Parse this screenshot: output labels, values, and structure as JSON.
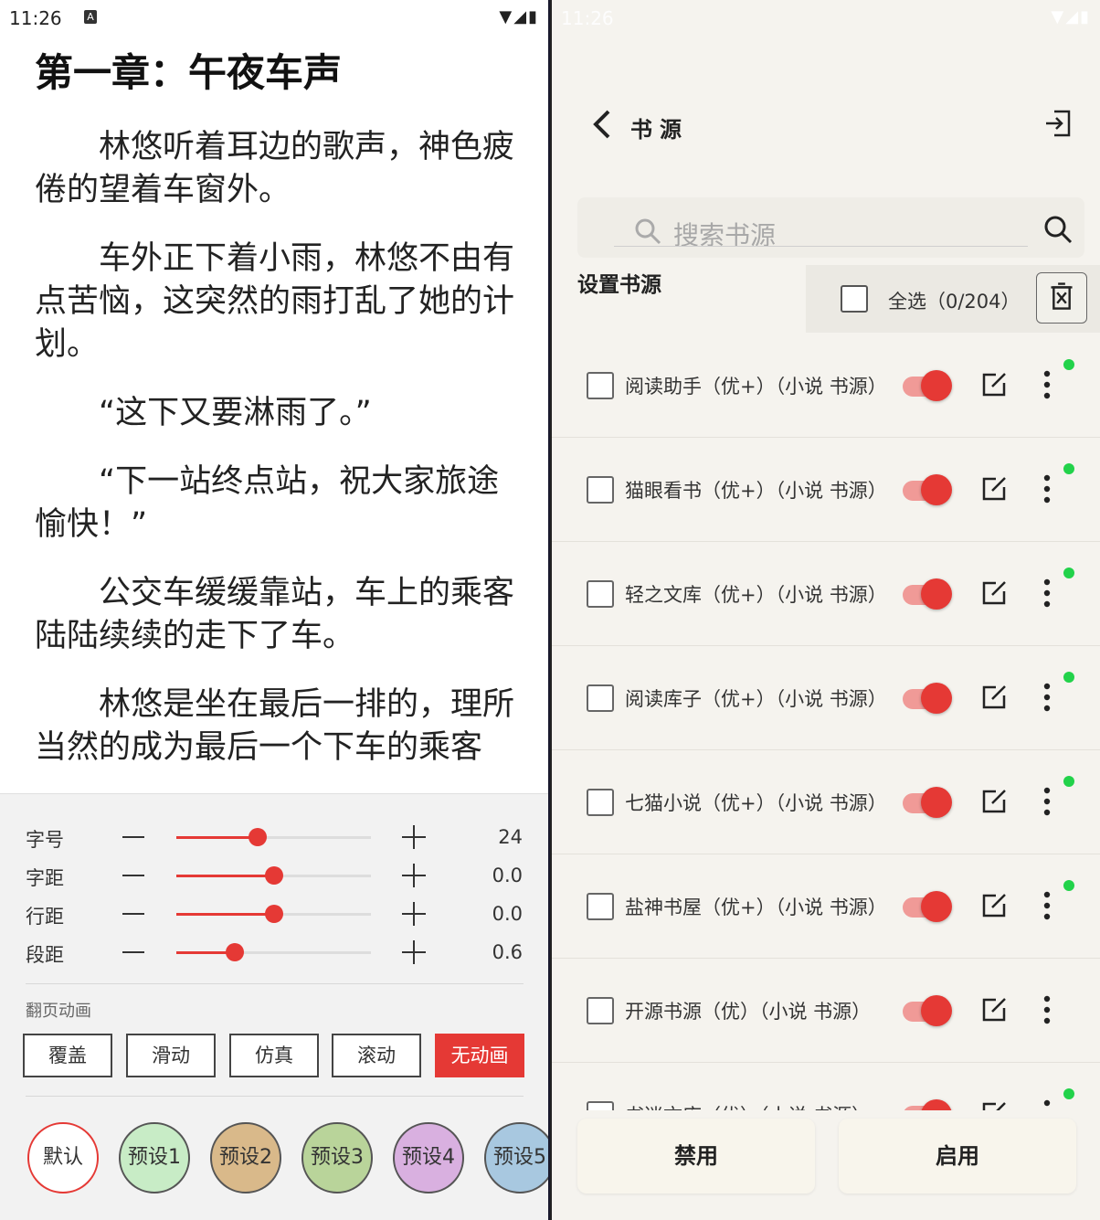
{
  "left": {
    "status": {
      "time": "11:26",
      "notif_letter": "A"
    },
    "chapter_title": "第一章：午夜车声",
    "paragraphs": [
      "林悠听着耳边的歌声，神色疲倦的望着车窗外。",
      "车外正下着小雨，林悠不由有点苦恼，这突然的雨打乱了她的计划。",
      "“这下又要淋雨了。”",
      "“下一站终点站，祝大家旅途愉快！”",
      "公交车缓缓靠站，车上的乘客陆陆续续的走下了车。",
      "林悠是坐在最后一排的，理所当然的成为最后一个下车的乘客"
    ],
    "settings": {
      "rows": [
        {
          "label": "字号",
          "value": "24",
          "slider": 0.42
        },
        {
          "label": "字距",
          "value": "0.0",
          "slider": 0.5
        },
        {
          "label": "行距",
          "value": "0.0",
          "slider": 0.5
        },
        {
          "label": "段距",
          "value": "0.6",
          "slider": 0.3
        }
      ],
      "anim_label": "翻页动画",
      "anim_buttons": [
        "覆盖",
        "滑动",
        "仿真",
        "滚动",
        "无动画"
      ],
      "anim_selected": "无动画",
      "presets": [
        {
          "label": "默认",
          "color": "#ffffff",
          "border": "#e53935"
        },
        {
          "label": "预设1",
          "color": "#c8ecc6"
        },
        {
          "label": "预设2",
          "color": "#d9b98a"
        },
        {
          "label": "预设3",
          "color": "#b9d49a"
        },
        {
          "label": "预设4",
          "color": "#d9b0e0"
        },
        {
          "label": "预设5",
          "color": "#a8c8e0"
        }
      ]
    }
  },
  "right": {
    "status": {
      "time": "11:26",
      "notif_letter": "A"
    },
    "title": "书源",
    "search_placeholder": "搜索书源",
    "section_title": "设置书源",
    "select_all": "全选（0/204）",
    "items": [
      {
        "name": "阅读助手（优+）（小说 书源）",
        "enabled": true,
        "dot": true
      },
      {
        "name": "猫眼看书（优+）（小说 书源）",
        "enabled": true,
        "dot": true
      },
      {
        "name": "轻之文库（优+）（小说 书源）",
        "enabled": true,
        "dot": true
      },
      {
        "name": "阅读库子（优+）（小说 书源）",
        "enabled": true,
        "dot": true
      },
      {
        "name": "七猫小说（优+）（小说 书源）",
        "enabled": true,
        "dot": true
      },
      {
        "name": "盐神书屋（优+）（小说 书源）",
        "enabled": true,
        "dot": true
      },
      {
        "name": "开源书源（优）（小说 书源）",
        "enabled": true,
        "dot": false
      },
      {
        "name": "书迷文库（优）（小说 书源）",
        "enabled": true,
        "dot": true
      }
    ],
    "disable_label": "禁用",
    "enable_label": "启用"
  },
  "colors": {
    "accent": "#e53935",
    "online_dot": "#22d24a"
  }
}
